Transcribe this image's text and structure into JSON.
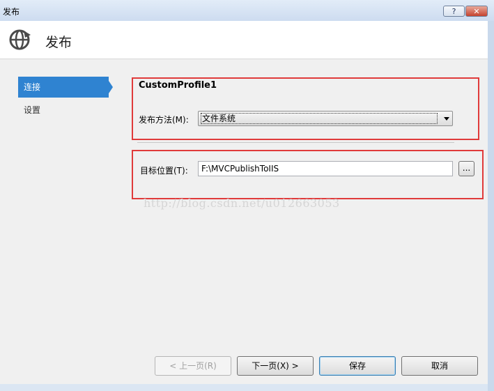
{
  "window": {
    "title": "发布",
    "help_label": "?",
    "close_label": "✕"
  },
  "header": {
    "title": "发布",
    "icon": "globe-publish-icon"
  },
  "sidebar": {
    "items": [
      {
        "label": "连接",
        "active": true
      },
      {
        "label": "设置",
        "active": false
      }
    ]
  },
  "connection": {
    "profile_name": "CustomProfile1",
    "method_label": "发布方法(M):",
    "method_value": "文件系统",
    "target_label": "目标位置(T):",
    "target_value": "F:\\MVCPublishToIIS",
    "browse_label": "..."
  },
  "watermark": "http://blog.csdn.net/u012663053",
  "footer": {
    "prev_label": "< 上一页(R)",
    "next_label": "下一页(X) >",
    "save_label": "保存",
    "cancel_label": "取消"
  },
  "colors": {
    "accent": "#2f83d1",
    "highlight_box": "#e03a3a"
  }
}
